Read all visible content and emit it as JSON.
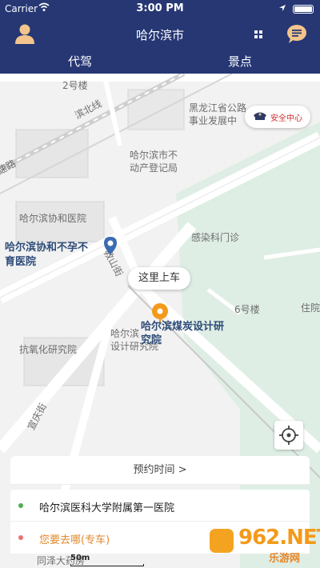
{
  "status_bar": {
    "carrier": "Carrier",
    "time": "3:00 PM"
  },
  "header": {
    "title": "哈尔滨市"
  },
  "tabs": [
    {
      "label": "代驾"
    },
    {
      "label": "景点"
    }
  ],
  "map": {
    "labels": [
      "2号楼",
      "滨北线",
      "黑龙江省公路",
      "事业发展中",
      "哈尔滨市不",
      "动产登记局",
      "速路",
      "哈尔滨协和医院",
      "感染科门诊",
      "6号楼",
      "住院",
      "教山街",
      "哈尔滨",
      "设计研究院",
      "抗氧化研究院",
      "宣庆街",
      "同泽大药房",
      "哈尔滨协和不孕不",
      "育医院",
      "哈尔滨煤炭设计研",
      "究院"
    ],
    "safety_label": "安全中心",
    "pickup_bubble": "这里上车",
    "scale": "50m"
  },
  "panel": {
    "reserve_label": "预约时间 >",
    "start_address": "哈尔滨医科大学附属第一医院",
    "destination_placeholder": "您要去哪(专车)"
  },
  "watermark": {
    "brand": "962.NET",
    "sub": "乐游网"
  },
  "colors": {
    "header_bg": "#263774",
    "start_dot": "#4caf50",
    "dest_dot": "#f07070",
    "pin": "#f39a1a"
  }
}
